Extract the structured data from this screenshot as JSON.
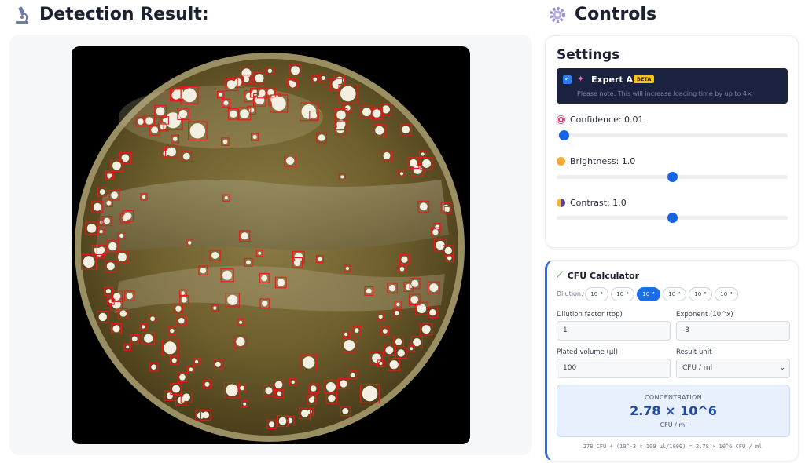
{
  "left_heading": {
    "title": "Detection Result:",
    "icon": "microscope-icon"
  },
  "right_heading": {
    "title": "Controls",
    "icon": "gear-icon"
  },
  "settings": {
    "title": "Settings",
    "expert": {
      "checked": true,
      "label": "Expert AI",
      "badge": "BETA",
      "note": "Please note: This will increase loading time by up to 4×"
    },
    "confidence": {
      "label": "Confidence: 0.01",
      "value": 0.01,
      "range": [
        0,
        1
      ]
    },
    "brightness": {
      "label": "Brightness: 1.0",
      "value": 1.0,
      "range": [
        0,
        2
      ]
    },
    "contrast": {
      "label": "Contrast: 1.0",
      "value": 1.0,
      "range": [
        0,
        2
      ]
    }
  },
  "calculator": {
    "title": "CFU Calculator",
    "dilution_label": "Dilution:",
    "dilutions": [
      "10⁻¹",
      "10⁻²",
      "10⁻³",
      "10⁻⁴",
      "10⁻⁵",
      "10⁻⁶"
    ],
    "active_dilution": "10⁻³",
    "dilution_factor_label": "Dilution factor (top)",
    "dilution_factor_value": "1",
    "exponent_label": "Exponent (10^x)",
    "exponent_value": "-3",
    "plated_volume_label": "Plated volume (µl)",
    "plated_volume_value": "100",
    "result_unit_label": "Result unit",
    "result_unit_value": "CFU / ml",
    "concentration_heading": "CONCENTRATION",
    "concentration_value": "2.78 × 10^6",
    "concentration_unit": "CFU / ml",
    "formula": "278 CFU ÷ (10^-3 × 100 µl/1000) = 2.78 × 10^6 CFU / ml"
  }
}
